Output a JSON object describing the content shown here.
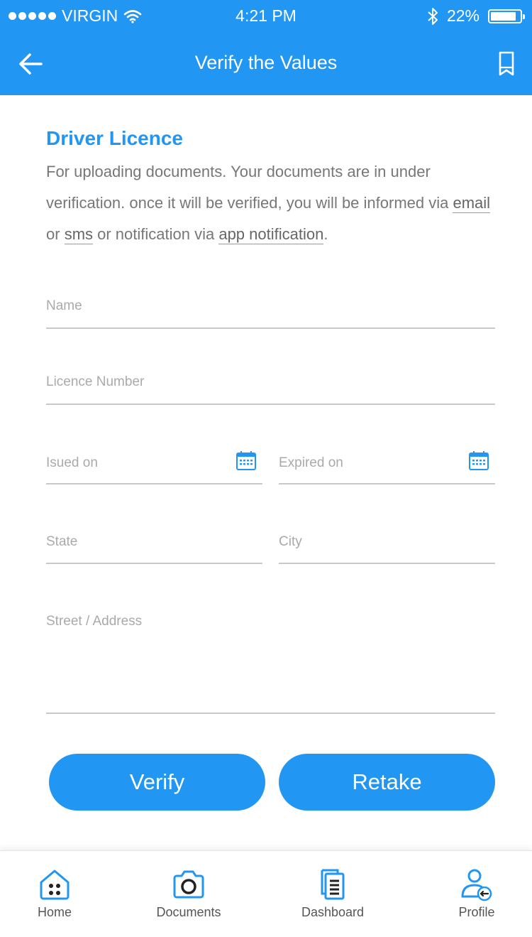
{
  "status_bar": {
    "carrier": "VIRGIN",
    "time": "4:21 PM",
    "battery_text": "22%",
    "battery_level": 0.22
  },
  "header": {
    "title": "Verify the Values",
    "back_icon": "arrow-left-icon",
    "action_icon": "bookmark-icon"
  },
  "section": {
    "title": "Driver Licence",
    "desc_part1": "For uploading documents. Your documents are in under verification. once it will be verified, you will be informed via ",
    "link_email": "email",
    "desc_or": " or ",
    "link_sms": "sms",
    "desc_part2": " or notification via ",
    "link_app": "app notification",
    "desc_end": "."
  },
  "form": {
    "name_placeholder": "Name",
    "licence_placeholder": "Licence Number",
    "issued_placeholder": "Isued on",
    "expired_placeholder": "Expired on",
    "state_placeholder": "State",
    "city_placeholder": "City",
    "address_placeholder": "Street / Address"
  },
  "buttons": {
    "verify": "Verify",
    "retake": "Retake"
  },
  "tabs": [
    {
      "label": "Home",
      "icon": "home-icon"
    },
    {
      "label": "Documents",
      "icon": "camera-icon"
    },
    {
      "label": "Dashboard",
      "icon": "documents-icon"
    },
    {
      "label": "Profile",
      "icon": "profile-icon"
    }
  ],
  "colors": {
    "accent": "#2196f3",
    "text_muted": "#777777",
    "placeholder": "#aaaaaa"
  }
}
